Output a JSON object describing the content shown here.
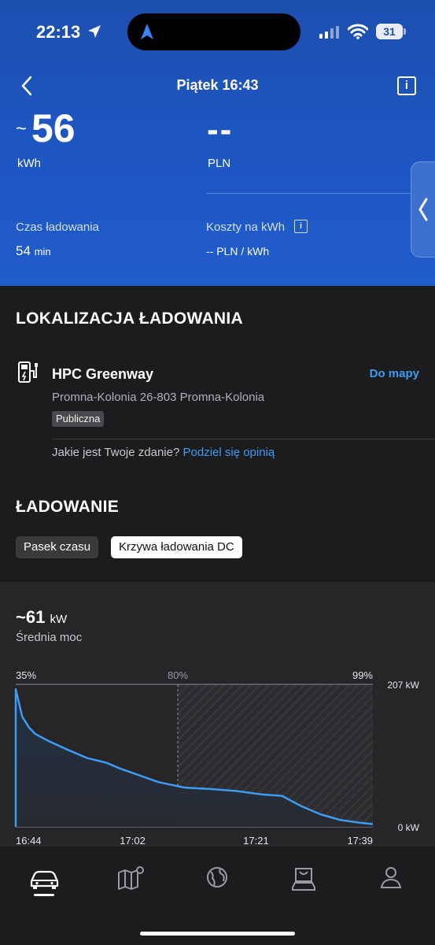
{
  "status_bar": {
    "time": "22:13",
    "battery": "31"
  },
  "header": {
    "title": "Piątek 16:43",
    "energy_prefix": "~",
    "energy_value": "56",
    "energy_unit": "kWh",
    "cost_value": "--",
    "cost_unit": "PLN",
    "charge_time_label": "Czas ładowania",
    "charge_time_value": "54",
    "charge_time_unit": "min",
    "cost_per_kwh_label": "Koszty na kWh",
    "cost_per_kwh_value": "-- PLN / kWh"
  },
  "location": {
    "section_title": "LOKALIZACJA ŁADOWANIA",
    "station_name": "HPC Greenway",
    "map_link": "Do mapy",
    "address": "Promna-Kolonia 26-803 Promna-Kolonia",
    "badge": "Publiczna",
    "opinion_question": "Jakie jest Twoje zdanie?",
    "opinion_link": "Podziel się opinią"
  },
  "charging": {
    "section_title": "ŁADOWANIE",
    "tabs": [
      {
        "label": "Pasek czasu",
        "active": false
      },
      {
        "label": "Krzywa ładowania DC",
        "active": true
      }
    ],
    "avg_prefix": "~",
    "avg_value": "61",
    "avg_unit": "kW",
    "avg_label": "Średnia moc"
  },
  "chart_data": {
    "type": "area",
    "x_unit": "time",
    "y_unit": "kW",
    "ylim": [
      0,
      207
    ],
    "y_tick_labels": [
      "207 kW",
      "0 kW"
    ],
    "x_tick_labels": [
      "16:44",
      "17:02",
      "17:21",
      "17:39"
    ],
    "soc_labels": [
      "35%",
      "80%",
      "99%"
    ],
    "threshold_label": "80%",
    "series": [
      {
        "x": [
          "16:44",
          "16:45",
          "16:46",
          "16:47",
          "16:49",
          "16:52",
          "16:55",
          "16:58",
          "17:00",
          "17:03",
          "17:06",
          "17:10",
          "17:14",
          "17:18",
          "17:22",
          "17:25",
          "17:28",
          "17:31",
          "17:34",
          "17:37",
          "17:39"
        ],
        "values": [
          200,
          160,
          145,
          135,
          125,
          112,
          100,
          93,
          85,
          75,
          65,
          57,
          55,
          52,
          47,
          45,
          30,
          18,
          10,
          6,
          4
        ]
      }
    ],
    "colors": {
      "line": "#3d9bf2",
      "grid": "#8e8e93"
    }
  },
  "bottom_nav": {
    "items": [
      {
        "name": "vehicle",
        "icon": "car-icon",
        "active": true
      },
      {
        "name": "map",
        "icon": "map-icon",
        "active": false
      },
      {
        "name": "globe",
        "icon": "globe-icon",
        "active": false
      },
      {
        "name": "shop",
        "icon": "shop-icon",
        "active": false
      },
      {
        "name": "profile",
        "icon": "profile-icon",
        "active": false
      }
    ]
  }
}
